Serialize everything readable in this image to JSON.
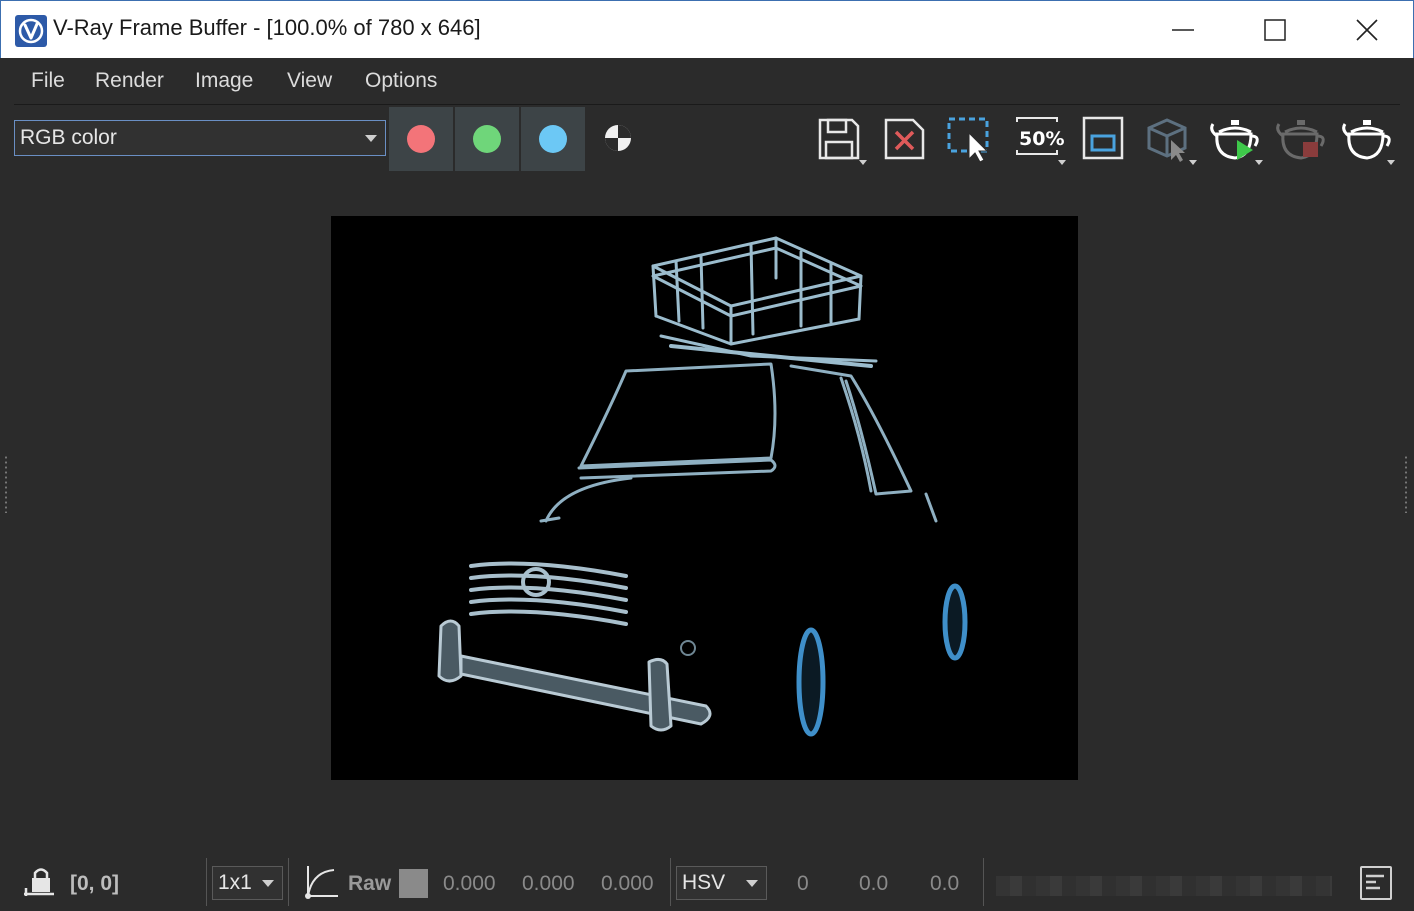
{
  "window": {
    "title": "V-Ray Frame Buffer - [100.0% of 780 x 646]",
    "app_icon": "vray-logo-icon",
    "buttons": [
      "minimize-icon",
      "maximize-icon",
      "close-icon"
    ]
  },
  "menu": {
    "items": [
      "File",
      "Render",
      "Image",
      "View",
      "Options"
    ]
  },
  "toolbar": {
    "channel_select": "RGB color",
    "channel_buttons": [
      {
        "name": "red-channel",
        "color": "#f37479"
      },
      {
        "name": "green-channel",
        "color": "#6fd67a"
      },
      {
        "name": "blue-channel",
        "color": "#6cc8f5"
      }
    ],
    "alpha_icon": "alpha-channel-icon",
    "zoom_label": "50%",
    "tools": [
      "save-image-icon",
      "clear-image-icon",
      "region-render-icon",
      "zoom-50-icon",
      "frame-icon",
      "interactive-render-icon",
      "start-render-icon",
      "stop-render-icon",
      "render-teapot-icon"
    ],
    "colors": {
      "accent": "#4aa3df",
      "play": "#3ec94a",
      "stop": "#c0504d"
    }
  },
  "render": {
    "description": "Rendered car with roof basket on black background"
  },
  "statusbar": {
    "coords": "[0, 0]",
    "sample_size": "1x1",
    "raw_label": "Raw",
    "values": [
      "0.000",
      "0.000",
      "0.000"
    ],
    "color_mode": "HSV",
    "hsv_values": [
      "0",
      "0.0",
      "0.0"
    ]
  }
}
